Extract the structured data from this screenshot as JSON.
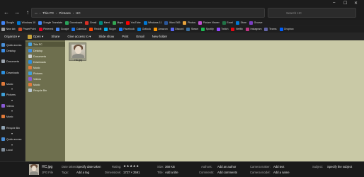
{
  "address": {
    "crumbs": [
      "This PC",
      "Pictures",
      "HC"
    ],
    "search_placeholder": "Search HC"
  },
  "window_controls": {
    "minimize": "–",
    "maximize": "☐",
    "close": "✕"
  },
  "bookmarks_row1": [
    {
      "label": "Google",
      "color": "#4285f4"
    },
    {
      "label": "Windows 10",
      "color": "#0078d4"
    },
    {
      "label": "Google Translate",
      "color": "#4285f4"
    },
    {
      "label": "Downloads",
      "color": "#2aa35a"
    },
    {
      "label": "Gmail",
      "color": "#d93025"
    },
    {
      "label": "Meet",
      "color": "#00897b"
    },
    {
      "label": "Maps",
      "color": "#34a853"
    },
    {
      "label": "YouTube",
      "color": "#ff0000"
    },
    {
      "label": "Windows 11",
      "color": "#0078d4"
    },
    {
      "label": "Word 365",
      "color": "#2b579a"
    },
    {
      "label": "Photos",
      "color": "#e8a33d"
    },
    {
      "label": "Picture Viewer",
      "color": "#c04fd0"
    },
    {
      "label": "Excel",
      "color": "#217346"
    },
    {
      "label": "Store",
      "color": "#0078d4"
    },
    {
      "label": "Groove",
      "color": "#7b3fc4"
    }
  ],
  "bookmarks_row2": [
    {
      "label": "New tab",
      "color": "#9e9e9e"
    },
    {
      "label": "PowerPoint",
      "color": "#d24726"
    },
    {
      "label": "Pinterest",
      "color": "#e60023"
    },
    {
      "label": "Google",
      "color": "#4285f4"
    },
    {
      "label": "Calendar",
      "color": "#1a73e8"
    },
    {
      "label": "Reddit",
      "color": "#ff4500"
    },
    {
      "label": "Skype",
      "color": "#00aff0"
    },
    {
      "label": "Facebook",
      "color": "#1877f2"
    },
    {
      "label": "Outlook",
      "color": "#0078d4"
    },
    {
      "label": "Amazon",
      "color": "#ff9900"
    },
    {
      "label": "Discord",
      "color": "#5865f2"
    },
    {
      "label": "Steam",
      "color": "#3a6e9e"
    },
    {
      "label": "Spotify",
      "color": "#1db954"
    },
    {
      "label": "Twitch",
      "color": "#9146ff"
    },
    {
      "label": "Netflix",
      "color": "#e50914"
    },
    {
      "label": "Instagram",
      "color": "#c13584"
    },
    {
      "label": "Teams",
      "color": "#6264a7"
    },
    {
      "label": "Dropbox",
      "color": "#0061ff"
    }
  ],
  "toolbar": {
    "organize": "Organize ▾",
    "open": "Open ▾",
    "share": "Share",
    "share_with": "Give access to ▾",
    "slideshow": "Slide show",
    "print": "Print",
    "email": "Email",
    "new_folder": "New folder"
  },
  "left_pane": [
    {
      "label": "Quick access"
    },
    {
      "label": "Desktop"
    },
    {
      "label": "Documents"
    },
    {
      "label": "Downloads"
    },
    {
      "label": "Music"
    },
    {
      "label": "Pictures"
    },
    {
      "label": "Videos"
    },
    {
      "label": "Music"
    },
    {
      "label": "Recycle Bin"
    },
    {
      "label": "Quick access"
    },
    {
      "label": "Local"
    }
  ],
  "nav_pane": {
    "selected": "This PC",
    "items": [
      "Desktop",
      "Documents",
      "Downloads",
      "Music",
      "Pictures",
      "Videos",
      "Music",
      "Recycle Bin"
    ]
  },
  "file": {
    "name": "HC.jpg"
  },
  "details": {
    "filename": "HC.jpg",
    "filetype": "JPG File",
    "date_taken_label": "Date taken:",
    "date_taken_value": "Specify date taken",
    "tags_label": "Tags:",
    "tags_value": "Add a tag",
    "rating_label": "Rating:",
    "rating_value": "★★★★★",
    "dimensions_label": "Dimensions:",
    "dimensions_value": "1727 × 2591",
    "size_label": "Size:",
    "size_value": "368 KB",
    "title_label": "Title:",
    "title_value": "Add a title",
    "authors_label": "Authors:",
    "authors_value": "Add an author",
    "comments_label": "Comments:",
    "comments_value": "Add comments",
    "camera_maker_label": "Camera maker:",
    "camera_maker_value": "Add text",
    "camera_model_label": "Camera model:",
    "camera_model_value": "Add a name",
    "subject_label": "Subject:",
    "subject_value": "Specify the subject"
  }
}
